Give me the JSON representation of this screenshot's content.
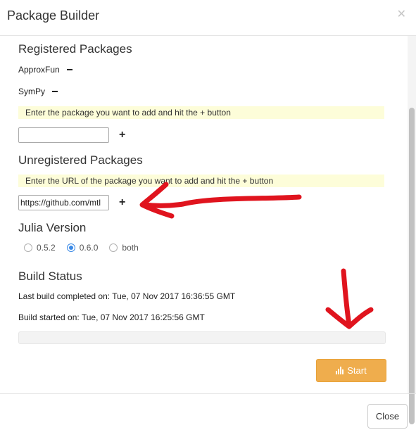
{
  "window": {
    "title": "Package Builder",
    "close_icon": "close-icon"
  },
  "registered": {
    "title": "Registered Packages",
    "packages": [
      "ApproxFun",
      "SymPy"
    ],
    "hint": "Enter the package you want to add and hit the + button",
    "input_value": "",
    "add_label": "+"
  },
  "unregistered": {
    "title": "Unregistered Packages",
    "hint": "Enter the URL of the package you want to add and hit the + button",
    "input_value": "https://github.com/mtl",
    "add_label": "+"
  },
  "julia": {
    "title": "Julia Version",
    "options": [
      "0.5.2",
      "0.6.0",
      "both"
    ],
    "selected": "0.6.0"
  },
  "build": {
    "title": "Build Status",
    "last_completed": "Last build completed on: Tue, 07 Nov 2017 16:36:55 GMT",
    "started": "Build started on: Tue, 07 Nov 2017 16:25:56 GMT",
    "progress_fraction": 0,
    "start_label": "Start",
    "start_icon": "bar-chart-icon"
  },
  "footer": {
    "close_label": "Close"
  },
  "colors": {
    "accent": "#3a89e6",
    "start_button": "#efad4d",
    "hint_bg": "#fdfdd9",
    "annotation_arrow": "#e0141e"
  }
}
